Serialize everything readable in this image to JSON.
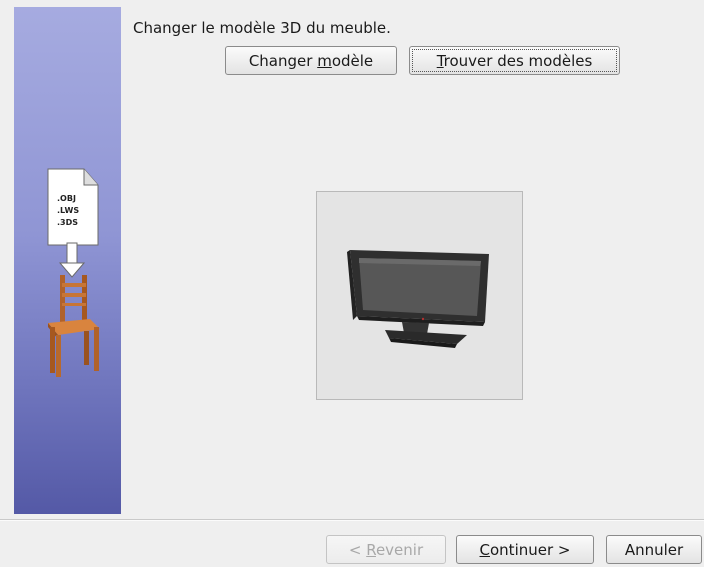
{
  "instruction": "Changer le modèle 3D du meuble.",
  "buttons": {
    "change_model": {
      "before": "Changer ",
      "mnemonic": "m",
      "after": "odèle"
    },
    "find_models": {
      "before": "",
      "mnemonic": "T",
      "after": "rouver des modèles"
    },
    "back": {
      "before": "< ",
      "mnemonic": "R",
      "after": "evenir"
    },
    "continue": {
      "before": "",
      "mnemonic": "C",
      "after": "ontinuer >"
    },
    "cancel": {
      "label": "Annuler"
    }
  },
  "sidebar": {
    "file_extensions": [
      ".OBJ",
      ".LWS",
      ".3DS"
    ],
    "colors": {
      "top": "#a6abe0",
      "bottom": "#5459a6"
    }
  },
  "preview": {
    "model_icon": "flat-screen-tv-icon"
  }
}
